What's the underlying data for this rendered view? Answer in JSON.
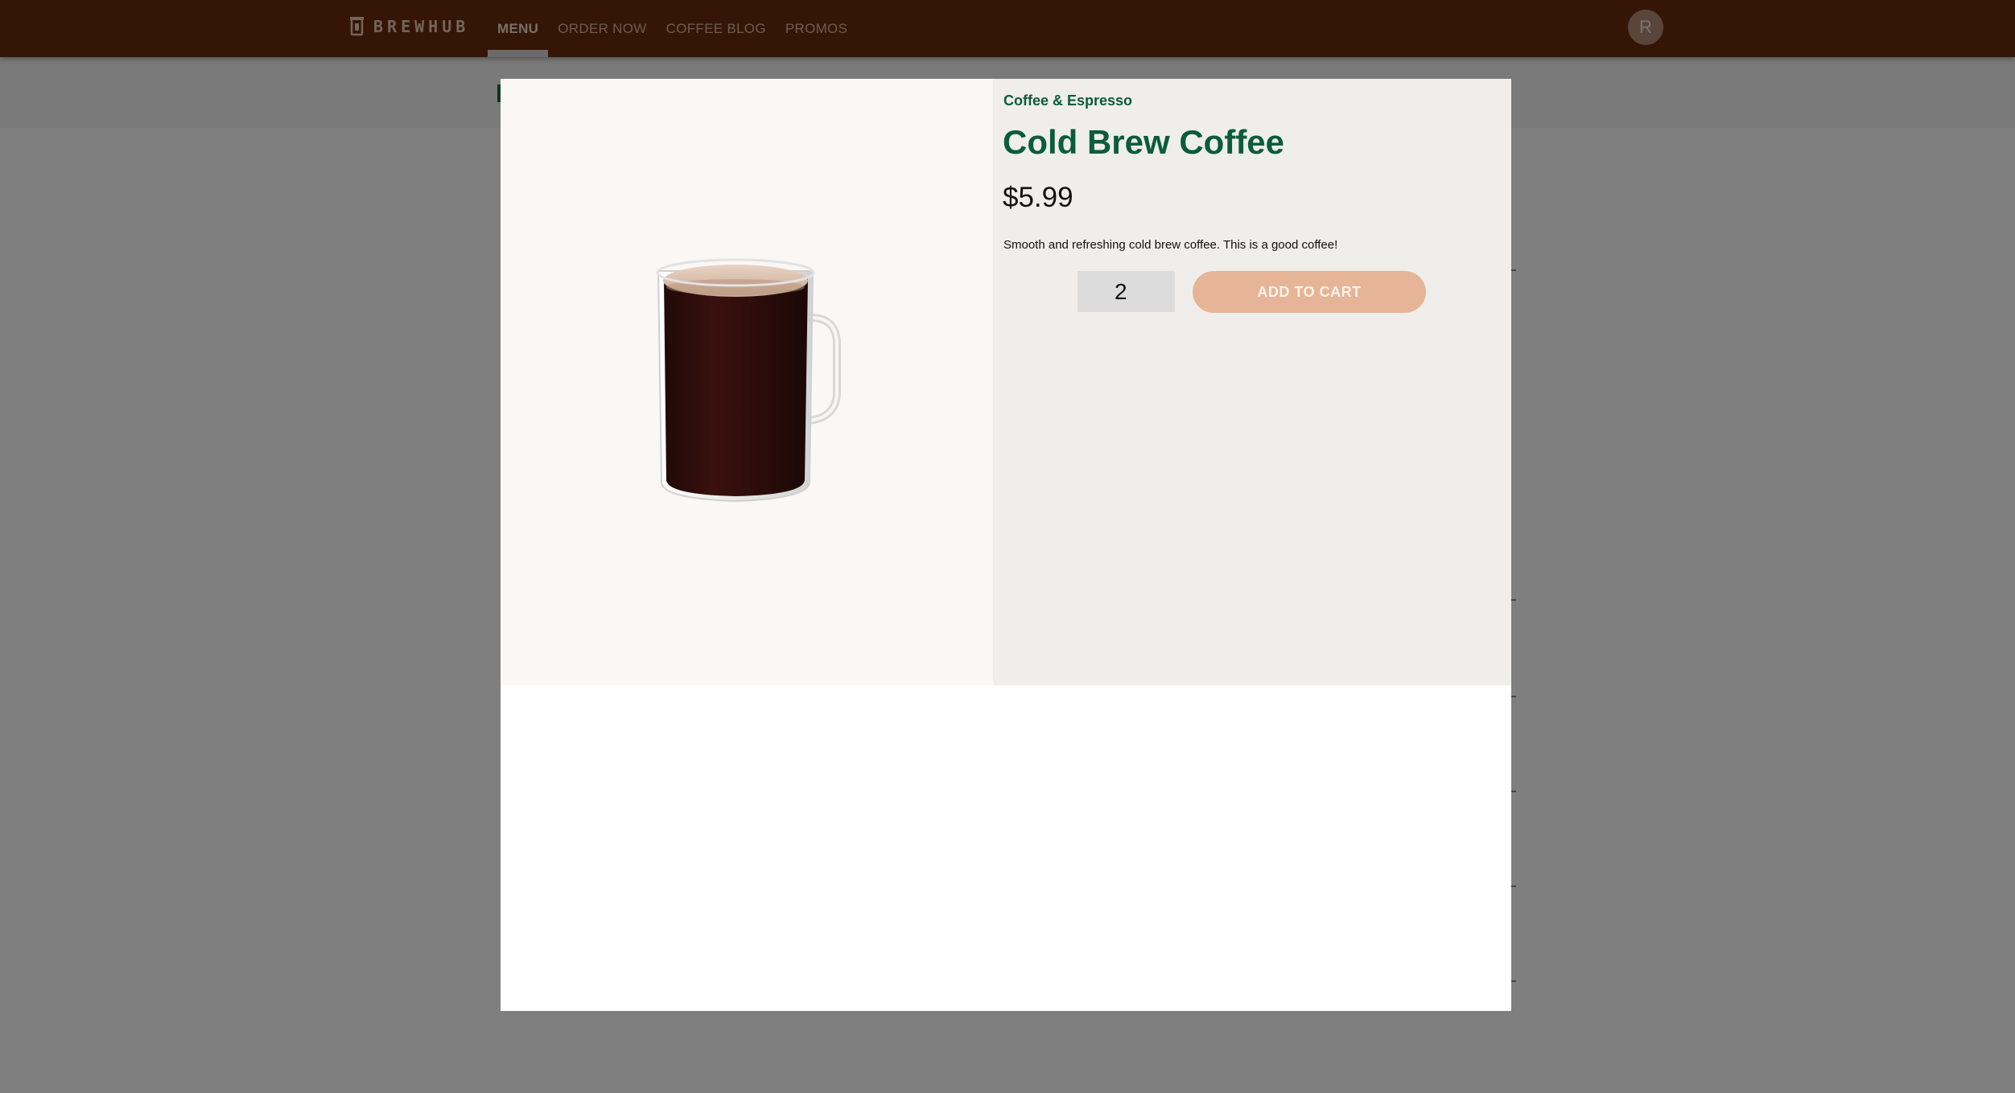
{
  "brand": {
    "name": "BREWHUB",
    "icon": "coffee-press-icon"
  },
  "nav": {
    "items": [
      {
        "label": "MENU",
        "active": true
      },
      {
        "label": "ORDER NOW",
        "active": false
      },
      {
        "label": "COFFEE BLOG",
        "active": false
      },
      {
        "label": "PROMOS",
        "active": false
      }
    ]
  },
  "user": {
    "avatar_initial": "R"
  },
  "product_modal": {
    "category": "Coffee & Espresso",
    "title": "Cold Brew Coffee",
    "price": "$5.99",
    "description": "Smooth and refreshing cold brew coffee. This is a good coffee!",
    "quantity": "2",
    "add_to_cart_label": "ADD TO CART",
    "image": "cold-brew-mug-image"
  },
  "colors": {
    "nav_bg": "#6b2c0c",
    "accent_green": "#0a5c3c",
    "add_button": "#e6b497",
    "overlay": "rgba(0,0,0,0.5)"
  }
}
